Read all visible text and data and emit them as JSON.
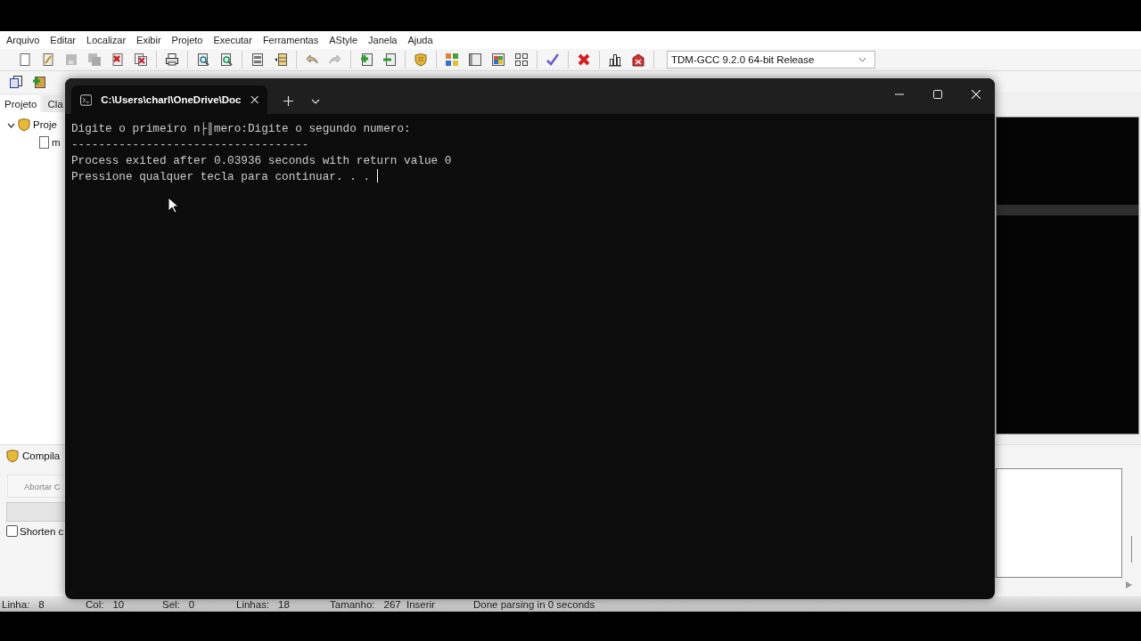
{
  "menu": [
    "Arquivo",
    "Editar",
    "Localizar",
    "Exibir",
    "Projeto",
    "Executar",
    "Ferramentas",
    "AStyle",
    "Janela",
    "Ajuda"
  ],
  "compiler_select": {
    "value": "TDM-GCC 9.2.0 64-bit Release"
  },
  "left_panel": {
    "tabs": [
      {
        "label": "Projeto",
        "selected": true
      },
      {
        "label": "Cla",
        "selected": false
      }
    ],
    "tree": [
      {
        "label": "Proje",
        "expanded": true,
        "children": [
          {
            "label": "m"
          }
        ]
      }
    ]
  },
  "compile_panel": {
    "tab": "Compila",
    "abort_button": {
      "label": "Abortar C",
      "disabled": true
    },
    "progress": {
      "level": 0
    },
    "shorten_checkbox": {
      "label": "Shorten c",
      "checked": false
    }
  },
  "status_bar": {
    "fields": [
      {
        "label": "Linha:",
        "value": "8"
      },
      {
        "label": "Col:",
        "value": "10"
      },
      {
        "label": "Sel:",
        "value": "0"
      },
      {
        "label": "Linhas:",
        "value": "18"
      },
      {
        "label": "Tamanho:",
        "value": "267"
      }
    ],
    "mode": "Inserir",
    "message": "Done parsing in 0 seconds"
  },
  "terminal": {
    "tab_title": "C:\\Users\\charl\\OneDrive\\Doc",
    "lines": [
      "Digite o primeiro n├║mero:Digite o segundo numero:",
      "-----------------------------------",
      "Process exited after 0.03936 seconds with return value 0",
      "Pressione qualquer tecla para continuar. . . "
    ]
  }
}
